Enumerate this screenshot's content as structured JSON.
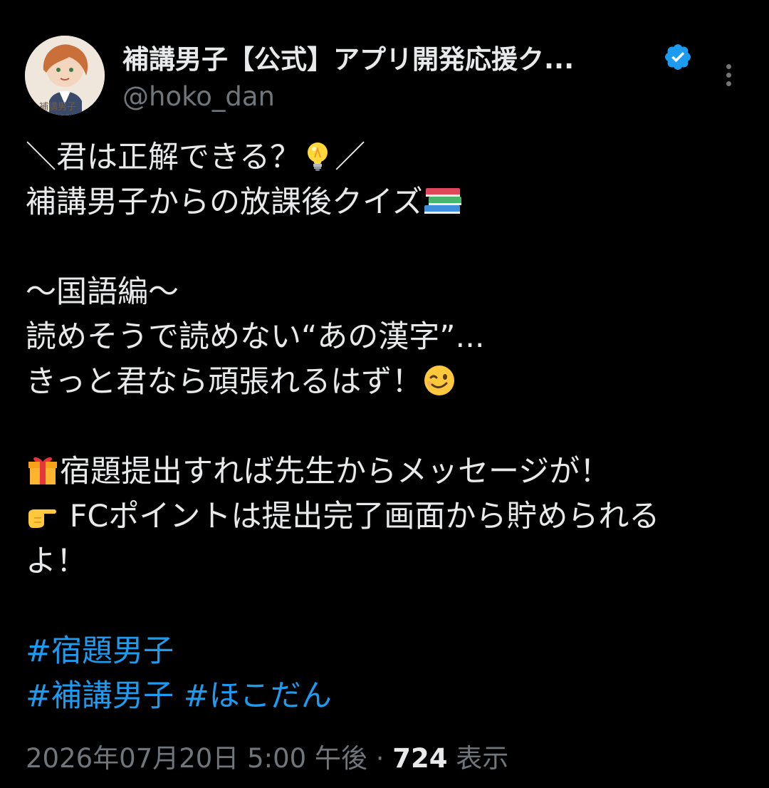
{
  "account": {
    "display_name": "補講男子【公式】アプリ開発応援ク...",
    "handle": "@hoko_dan",
    "avatar_caption": "補講男子",
    "verified": true
  },
  "tweet": {
    "line1_pre": "＼君は正解できる？",
    "line1_emoji": "light-bulb",
    "line1_post": "／",
    "line2_text": "補講男子からの放課後クイズ",
    "line2_emoji": "books",
    "line3": "〜国語編〜",
    "line4": "読めそうで読めない“あの漢字”...",
    "line5_text": "きっと君なら頑張れるはず！",
    "line5_emoji": "winking-face",
    "line6_emoji": "wrapped-gift",
    "line6_text": "宿題提出すれば先生からメッセージが！",
    "line7_emoji": "pointing-right",
    "line7_text": " FCポイントは提出完了画面から貯められる",
    "line8": "よ！",
    "hashtags": [
      "#宿題男子",
      "#補講男子",
      "#ほこだん"
    ]
  },
  "meta": {
    "timestamp": "2026年07月20日 5:00 午後",
    "separator": " · ",
    "views_count": "724",
    "views_label": " 表示"
  },
  "colors": {
    "background": "#000000",
    "text": "#e7e9ea",
    "secondary": "#71767b",
    "link": "#1d9bf0"
  }
}
